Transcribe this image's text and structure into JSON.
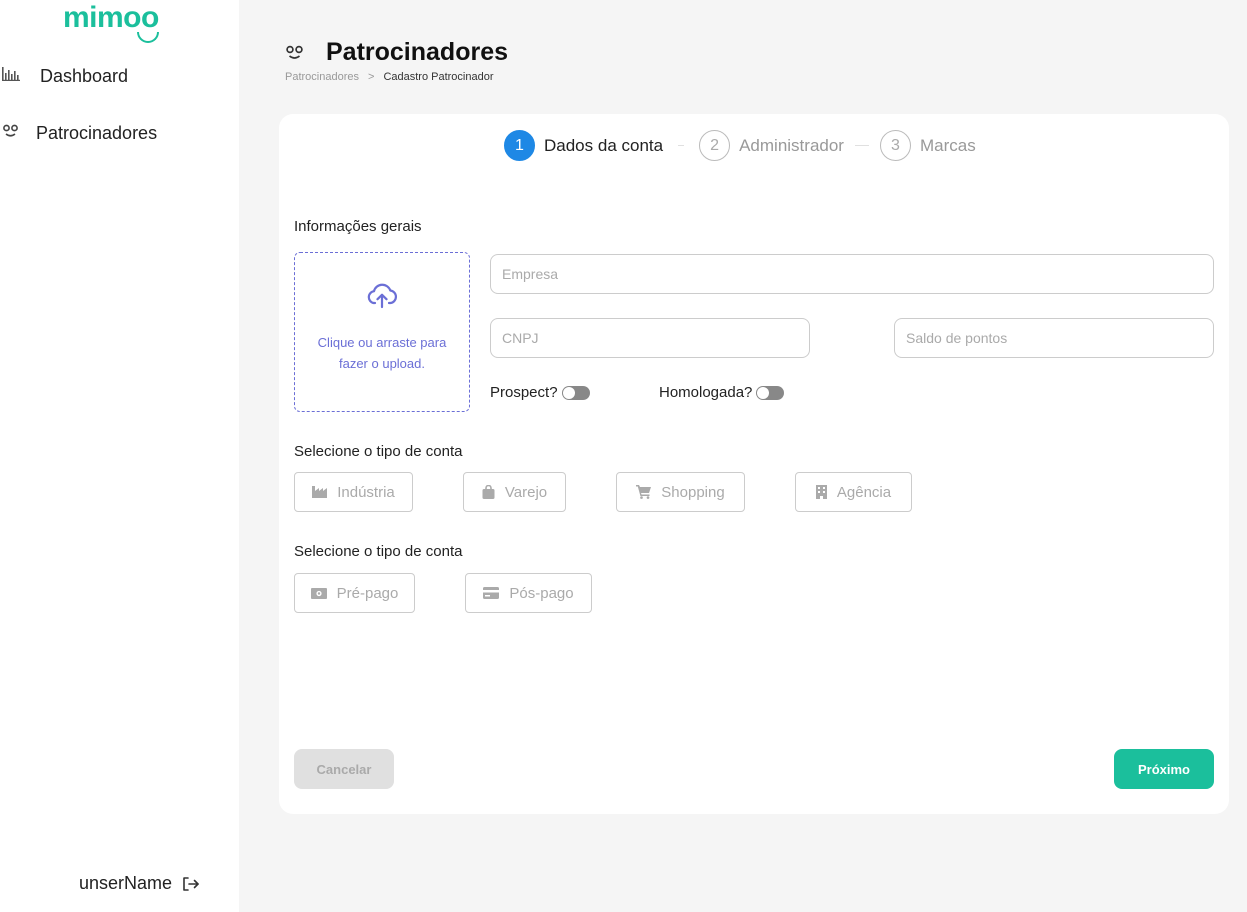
{
  "brand": {
    "name": "mimoo",
    "color": "#1bbf9c"
  },
  "sidebar": {
    "items": [
      {
        "label": "Dashboard",
        "icon": "bar-chart-icon"
      },
      {
        "label": "Patrocinadores",
        "icon": "sponsor-icon"
      }
    ],
    "user": {
      "name": "unserName",
      "logout_icon": "logout-icon"
    }
  },
  "header": {
    "title": "Patrocinadores",
    "icon": "sponsor-icon",
    "breadcrumb": {
      "parent": "Patrocinadores",
      "separator": ">",
      "current": "Cadastro Patrocinador"
    }
  },
  "stepper": {
    "steps": [
      {
        "number": "1",
        "label": "Dados da conta",
        "active": true
      },
      {
        "number": "2",
        "label": "Administrador",
        "active": false
      },
      {
        "number": "3",
        "label": "Marcas",
        "active": false
      }
    ],
    "active_color": "#1e88e5"
  },
  "form": {
    "general_info_label": "Informações gerais",
    "upload": {
      "text": "Clique ou arraste para fazer o upload.",
      "icon": "cloud-upload-icon",
      "color": "#6b6fd6"
    },
    "empresa": {
      "placeholder": "Empresa",
      "value": ""
    },
    "cnpj": {
      "placeholder": "CNPJ",
      "value": ""
    },
    "saldo": {
      "placeholder": "Saldo de pontos",
      "value": ""
    },
    "prospect": {
      "label": "Prospect?",
      "checked": false
    },
    "homologada": {
      "label": "Homologada?",
      "checked": false
    },
    "account_type_label": "Selecione o tipo de conta",
    "account_types": [
      {
        "label": "Indústria",
        "icon": "factory-icon"
      },
      {
        "label": "Varejo",
        "icon": "shopping-bag-icon"
      },
      {
        "label": "Shopping",
        "icon": "cart-icon"
      },
      {
        "label": "Agência",
        "icon": "building-icon"
      }
    ],
    "payment_type_label": "Selecione o tipo de conta",
    "payment_types": [
      {
        "label": "Pré-pago",
        "icon": "money-icon"
      },
      {
        "label": "Pós-pago",
        "icon": "credit-card-icon"
      }
    ]
  },
  "actions": {
    "cancel_label": "Cancelar",
    "next_label": "Próximo"
  }
}
